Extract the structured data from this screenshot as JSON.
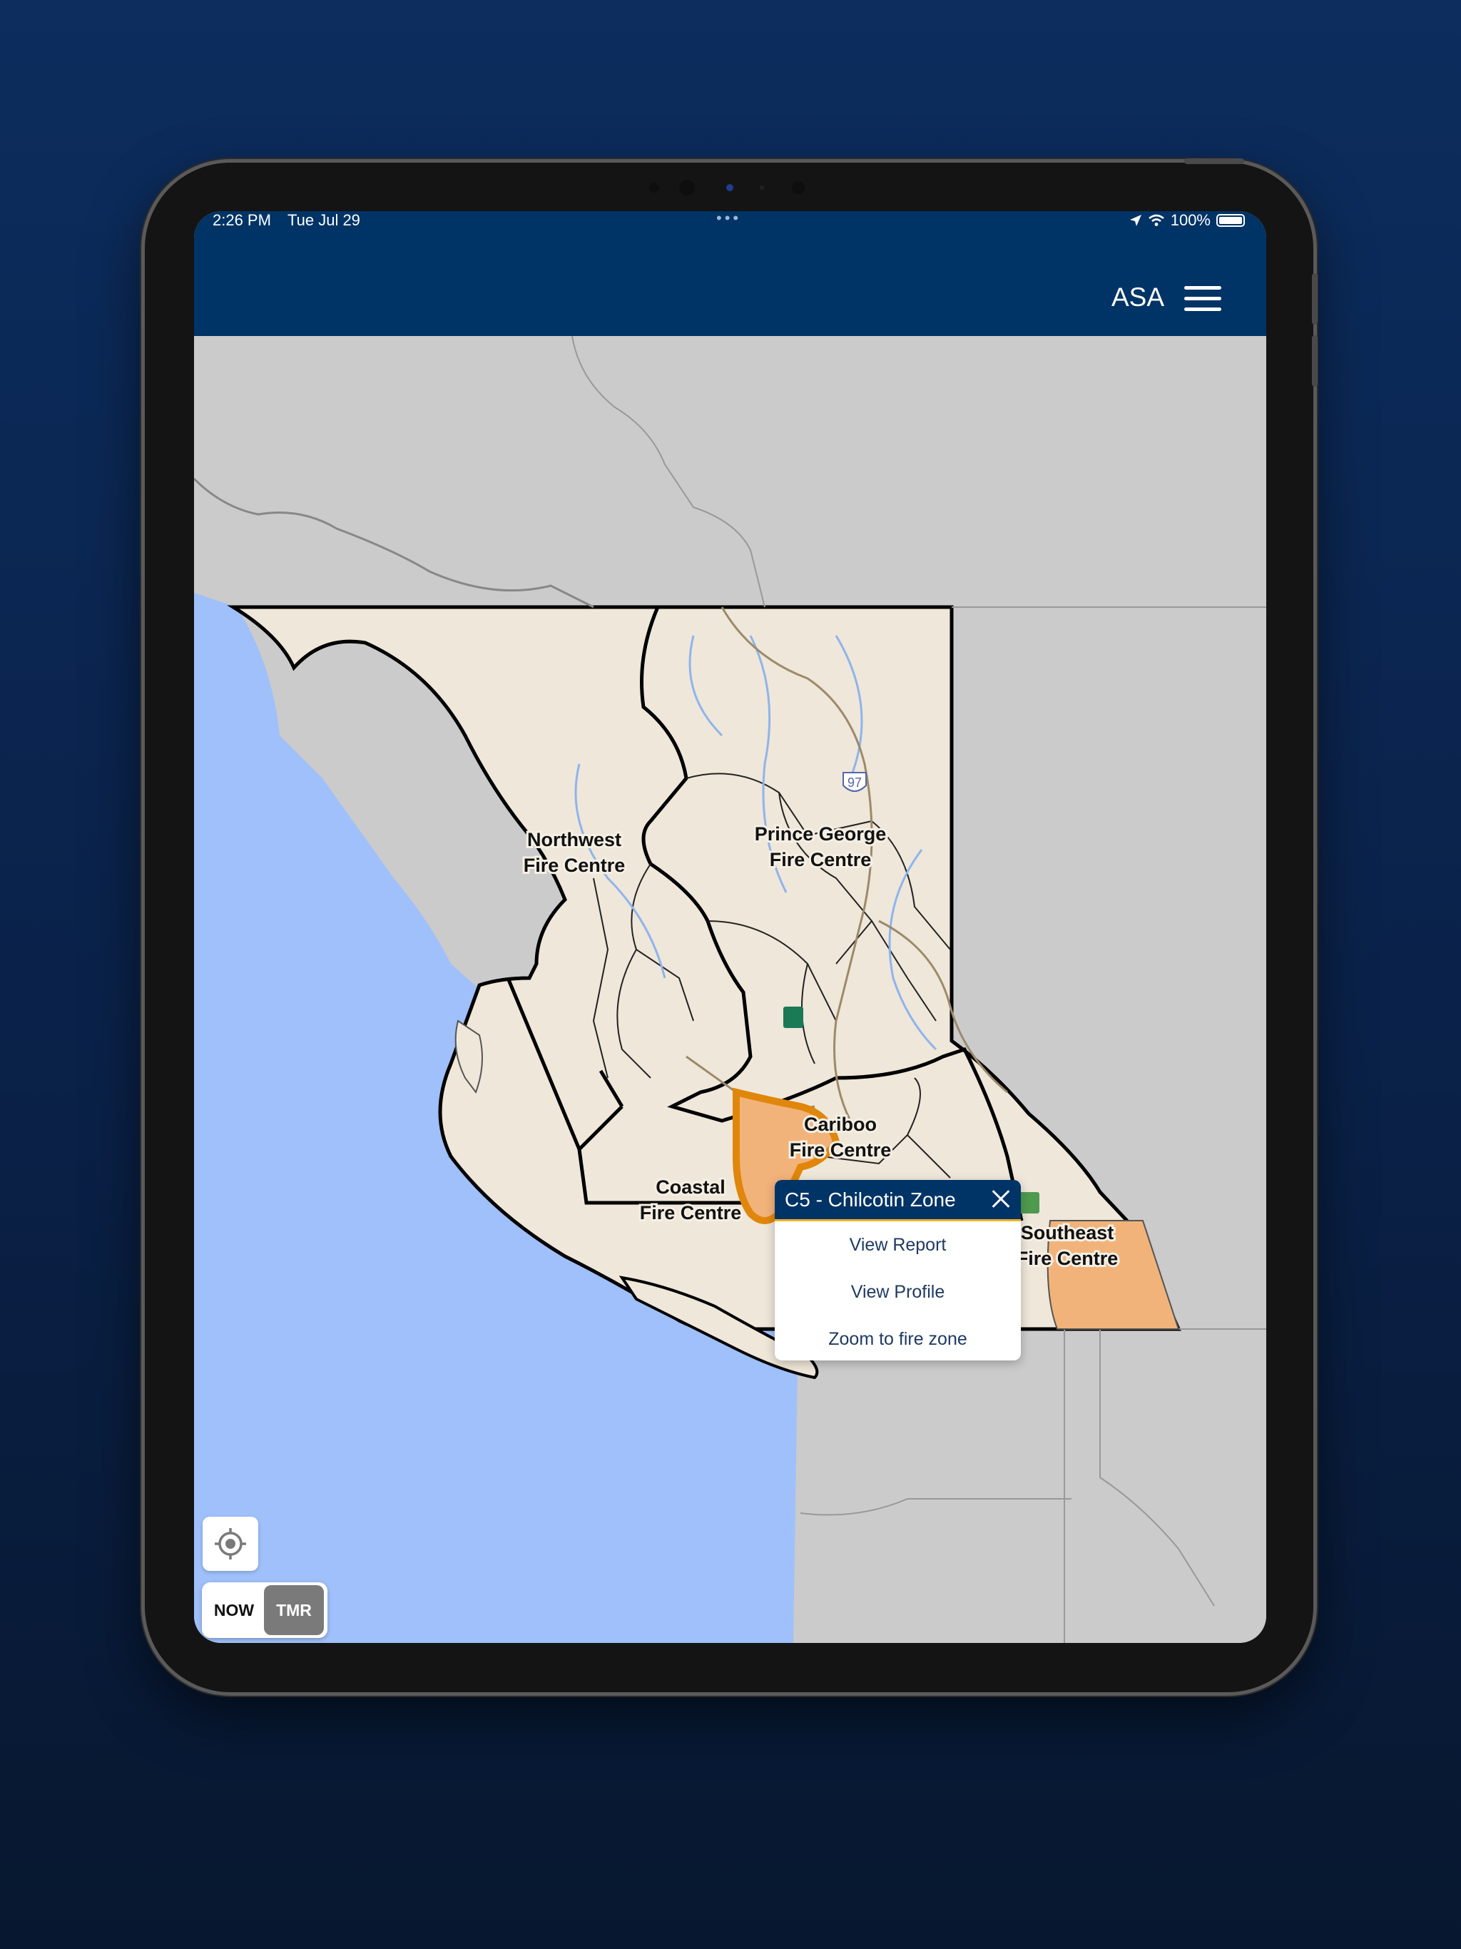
{
  "status_bar": {
    "time": "2:26 PM",
    "date": "Tue Jul 29",
    "battery": "100%"
  },
  "header": {
    "title": "ASA",
    "menu_icon": "hamburger-menu-icon",
    "background_color": "#003366"
  },
  "map": {
    "labels": {
      "northwest": [
        "Northwest",
        "Fire Centre"
      ],
      "prince_george": [
        "Prince George",
        "Fire Centre"
      ],
      "cariboo": [
        "Cariboo",
        "Fire Centre"
      ],
      "coastal": [
        "Coastal",
        "Fire Centre"
      ],
      "southeast": [
        "Southeast",
        "Fire Centre"
      ],
      "highway": "97"
    },
    "colors": {
      "water": "#9fc0fa",
      "land": "#efe7d9",
      "outside": "#cbcbcb",
      "selected_zone": "#f2b37a",
      "selected_outline": "#e0860b"
    }
  },
  "popup": {
    "title": "C5 - Chilcotin Zone",
    "items": [
      "View Report",
      "View Profile",
      "Zoom to fire zone"
    ]
  },
  "controls": {
    "locate_icon": "locate-icon",
    "toggle": {
      "now": "NOW",
      "tmr": "TMR",
      "selected": "TMR"
    }
  }
}
